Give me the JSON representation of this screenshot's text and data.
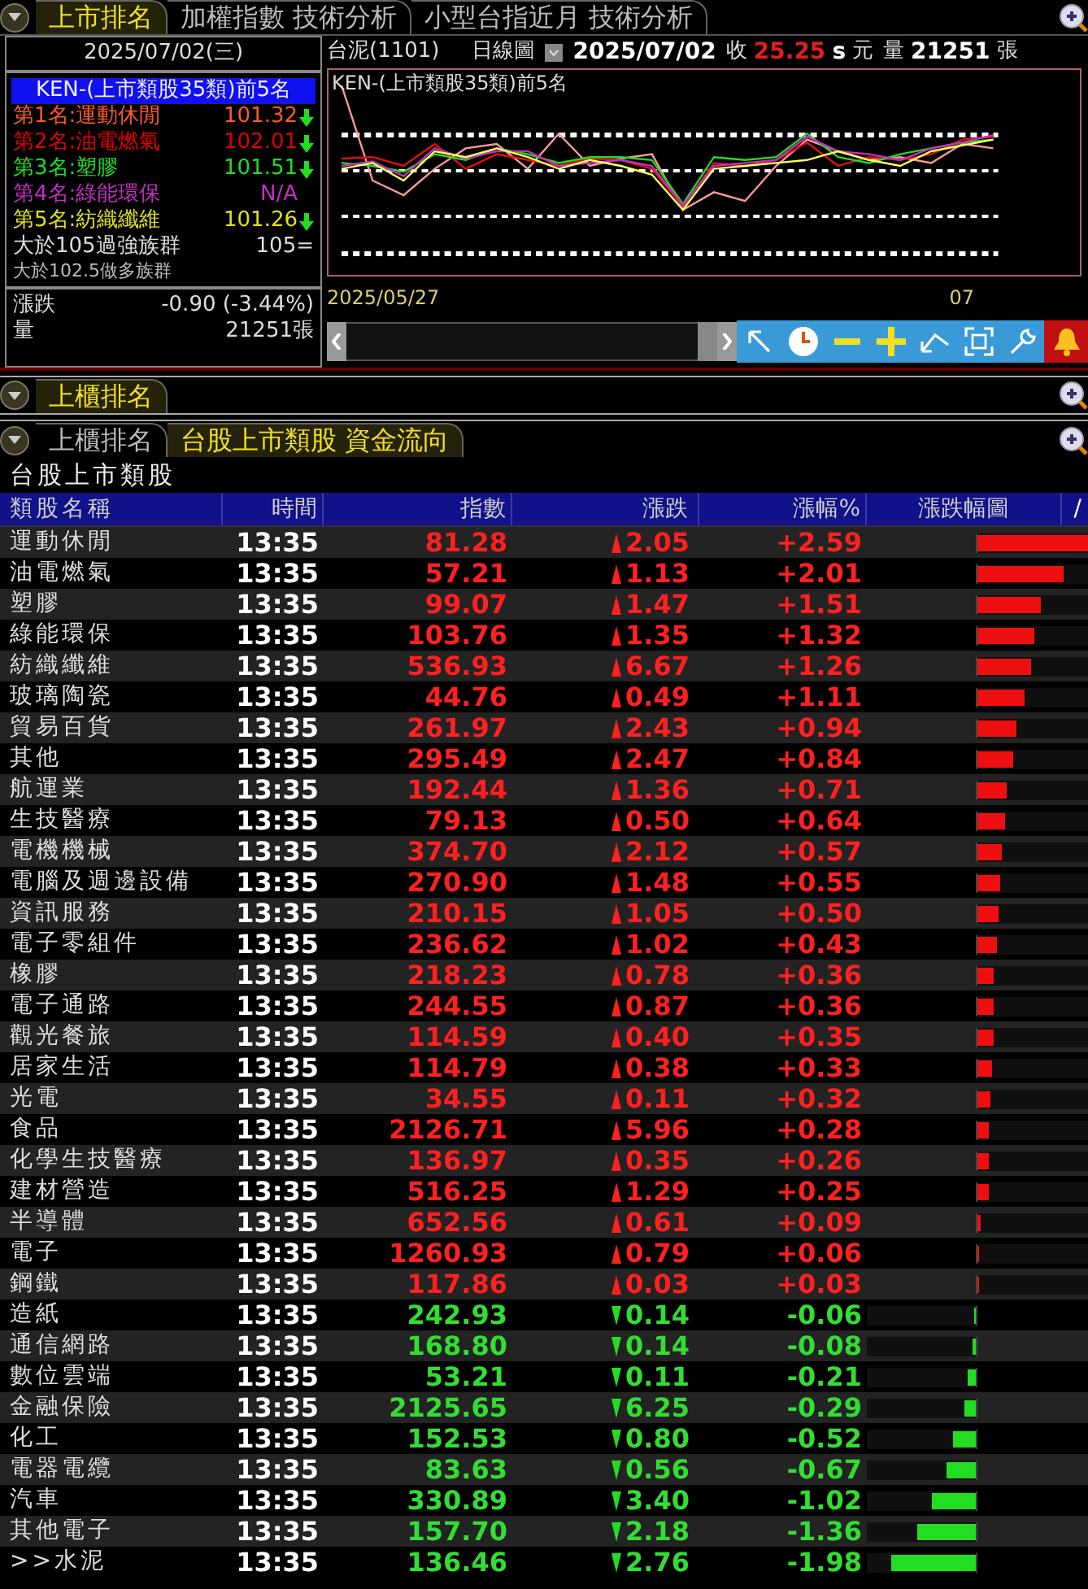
{
  "top_tabs": [
    {
      "label": "上市排名",
      "selected": true
    },
    {
      "label": "加權指數 技術分析",
      "selected": false
    },
    {
      "label": "小型台指近月 技術分析",
      "selected": false
    }
  ],
  "left_panel": {
    "date": "2025/07/02(三)",
    "header": "KEN-(上市類股35類)前5名",
    "ranks": [
      {
        "label": "第1名:運動休閒",
        "value": "101.32",
        "color": "#ff5a2a",
        "falling": true
      },
      {
        "label": "第2名:油電燃氣",
        "value": "102.01",
        "color": "#e00000",
        "falling": true
      },
      {
        "label": "第3名:塑膠",
        "value": "101.51",
        "color": "#22dd22",
        "falling": true
      },
      {
        "label": "第4名:綠能環保",
        "value": "N/A",
        "color": "#c030c0",
        "falling": false
      },
      {
        "label": "第5名:紡織纖維",
        "value": "101.26",
        "color": "#e0e020",
        "falling": true
      }
    ],
    "strong_label": "大於105過強族群",
    "strong_value": "105=",
    "bull_label": "大於102.5做多族群",
    "change_label": "漲跌",
    "change_value": "-0.90 (-3.44%)",
    "volume_label": "量",
    "volume_value": "21251張"
  },
  "chart_panel": {
    "stock": "台泥(1101)",
    "period": "日線圖",
    "date": "2025/07/02",
    "close_label": "收",
    "close_value": "25.25",
    "unit_s": "s",
    "unit": "元",
    "volume_label": "量",
    "volume_value": "21251",
    "volume_unit": "張",
    "chart_title": "KEN-(上市類股35類)前5名",
    "x_start": "2025/05/27",
    "x_end": "07"
  },
  "otc_tabs": [
    {
      "label": "上櫃排名",
      "selected": true
    }
  ],
  "lower_tabs": [
    {
      "label": "上櫃排名",
      "selected": false
    },
    {
      "label": "台股上市類股 資金流向",
      "selected": true
    }
  ],
  "table": {
    "title": "台股上市類股",
    "columns": [
      "類股名稱",
      "時間",
      "指數",
      "漲跌",
      "漲幅%",
      "漲跌幅圖"
    ],
    "corner": "/",
    "rows": [
      {
        "name": "運動休閒",
        "time": "13:35",
        "index": "81.28",
        "change": "2.05",
        "pct": "+2.59",
        "rising": true,
        "level": 1
      },
      {
        "name": "油電燃氣",
        "time": "13:35",
        "index": "57.21",
        "change": "1.13",
        "pct": "+2.01",
        "rising": true,
        "level": 0.78
      },
      {
        "name": "塑膠",
        "time": "13:35",
        "index": "99.07",
        "change": "1.47",
        "pct": "+1.51",
        "rising": true,
        "level": 0.58
      },
      {
        "name": "綠能環保",
        "time": "13:35",
        "index": "103.76",
        "change": "1.35",
        "pct": "+1.32",
        "rising": true,
        "level": 0.51
      },
      {
        "name": "紡織纖維",
        "time": "13:35",
        "index": "536.93",
        "change": "6.67",
        "pct": "+1.26",
        "rising": true,
        "level": 0.49
      },
      {
        "name": "玻璃陶瓷",
        "time": "13:35",
        "index": "44.76",
        "change": "0.49",
        "pct": "+1.11",
        "rising": true,
        "level": 0.43
      },
      {
        "name": "貿易百貨",
        "time": "13:35",
        "index": "261.97",
        "change": "2.43",
        "pct": "+0.94",
        "rising": true,
        "level": 0.36
      },
      {
        "name": "其他",
        "time": "13:35",
        "index": "295.49",
        "change": "2.47",
        "pct": "+0.84",
        "rising": true,
        "level": 0.32
      },
      {
        "name": "航運業",
        "time": "13:35",
        "index": "192.44",
        "change": "1.36",
        "pct": "+0.71",
        "rising": true,
        "level": 0.27
      },
      {
        "name": "生技醫療",
        "time": "13:35",
        "index": "79.13",
        "change": "0.50",
        "pct": "+0.64",
        "rising": true,
        "level": 0.25
      },
      {
        "name": "電機機械",
        "time": "13:35",
        "index": "374.70",
        "change": "2.12",
        "pct": "+0.57",
        "rising": true,
        "level": 0.22
      },
      {
        "name": "電腦及週邊設備",
        "time": "13:35",
        "index": "270.90",
        "change": "1.48",
        "pct": "+0.55",
        "rising": true,
        "level": 0.21
      },
      {
        "name": "資訊服務",
        "time": "13:35",
        "index": "210.15",
        "change": "1.05",
        "pct": "+0.50",
        "rising": true,
        "level": 0.19
      },
      {
        "name": "電子零組件",
        "time": "13:35",
        "index": "236.62",
        "change": "1.02",
        "pct": "+0.43",
        "rising": true,
        "level": 0.17
      },
      {
        "name": "橡膠",
        "time": "13:35",
        "index": "218.23",
        "change": "0.78",
        "pct": "+0.36",
        "rising": true,
        "level": 0.14
      },
      {
        "name": "電子通路",
        "time": "13:35",
        "index": "244.55",
        "change": "0.87",
        "pct": "+0.36",
        "rising": true,
        "level": 0.14
      },
      {
        "name": "觀光餐旅",
        "time": "13:35",
        "index": "114.59",
        "change": "0.40",
        "pct": "+0.35",
        "rising": true,
        "level": 0.14
      },
      {
        "name": "居家生活",
        "time": "13:35",
        "index": "114.79",
        "change": "0.38",
        "pct": "+0.33",
        "rising": true,
        "level": 0.13
      },
      {
        "name": "光電",
        "time": "13:35",
        "index": "34.55",
        "change": "0.11",
        "pct": "+0.32",
        "rising": true,
        "level": 0.12
      },
      {
        "name": "食品",
        "time": "13:35",
        "index": "2126.71",
        "change": "5.96",
        "pct": "+0.28",
        "rising": true,
        "level": 0.11
      },
      {
        "name": "化學生技醫療",
        "time": "13:35",
        "index": "136.97",
        "change": "0.35",
        "pct": "+0.26",
        "rising": true,
        "level": 0.1
      },
      {
        "name": "建材營造",
        "time": "13:35",
        "index": "516.25",
        "change": "1.29",
        "pct": "+0.25",
        "rising": true,
        "level": 0.1
      },
      {
        "name": "半導體",
        "time": "13:35",
        "index": "652.56",
        "change": "0.61",
        "pct": "+0.09",
        "rising": true,
        "level": 0.03
      },
      {
        "name": "電子",
        "time": "13:35",
        "index": "1260.93",
        "change": "0.79",
        "pct": "+0.06",
        "rising": true,
        "level": 0.02
      },
      {
        "name": "鋼鐵",
        "time": "13:35",
        "index": "117.86",
        "change": "0.03",
        "pct": "+0.03",
        "rising": true,
        "level": 0.01
      },
      {
        "name": "造紙",
        "time": "13:35",
        "index": "242.93",
        "change": "0.14",
        "pct": "-0.06",
        "rising": false,
        "level": 0.02
      },
      {
        "name": "通信網路",
        "time": "13:35",
        "index": "168.80",
        "change": "0.14",
        "pct": "-0.08",
        "rising": false,
        "level": 0.03
      },
      {
        "name": "數位雲端",
        "time": "13:35",
        "index": "53.21",
        "change": "0.11",
        "pct": "-0.21",
        "rising": false,
        "level": 0.08
      },
      {
        "name": "金融保險",
        "time": "13:35",
        "index": "2125.65",
        "change": "6.25",
        "pct": "-0.29",
        "rising": false,
        "level": 0.11
      },
      {
        "name": "化工",
        "time": "13:35",
        "index": "152.53",
        "change": "0.80",
        "pct": "-0.52",
        "rising": false,
        "level": 0.2
      },
      {
        "name": "電器電纜",
        "time": "13:35",
        "index": "83.63",
        "change": "0.56",
        "pct": "-0.67",
        "rising": false,
        "level": 0.26
      },
      {
        "name": "汽車",
        "time": "13:35",
        "index": "330.89",
        "change": "3.40",
        "pct": "-1.02",
        "rising": false,
        "level": 0.39
      },
      {
        "name": "其他電子",
        "time": "13:35",
        "index": "157.70",
        "change": "2.18",
        "pct": "-1.36",
        "rising": false,
        "level": 0.53
      },
      {
        "name": ">>水泥",
        "time": "13:35",
        "index": "136.46",
        "change": "2.76",
        "pct": "-1.98",
        "rising": false,
        "level": 0.76
      }
    ]
  }
}
